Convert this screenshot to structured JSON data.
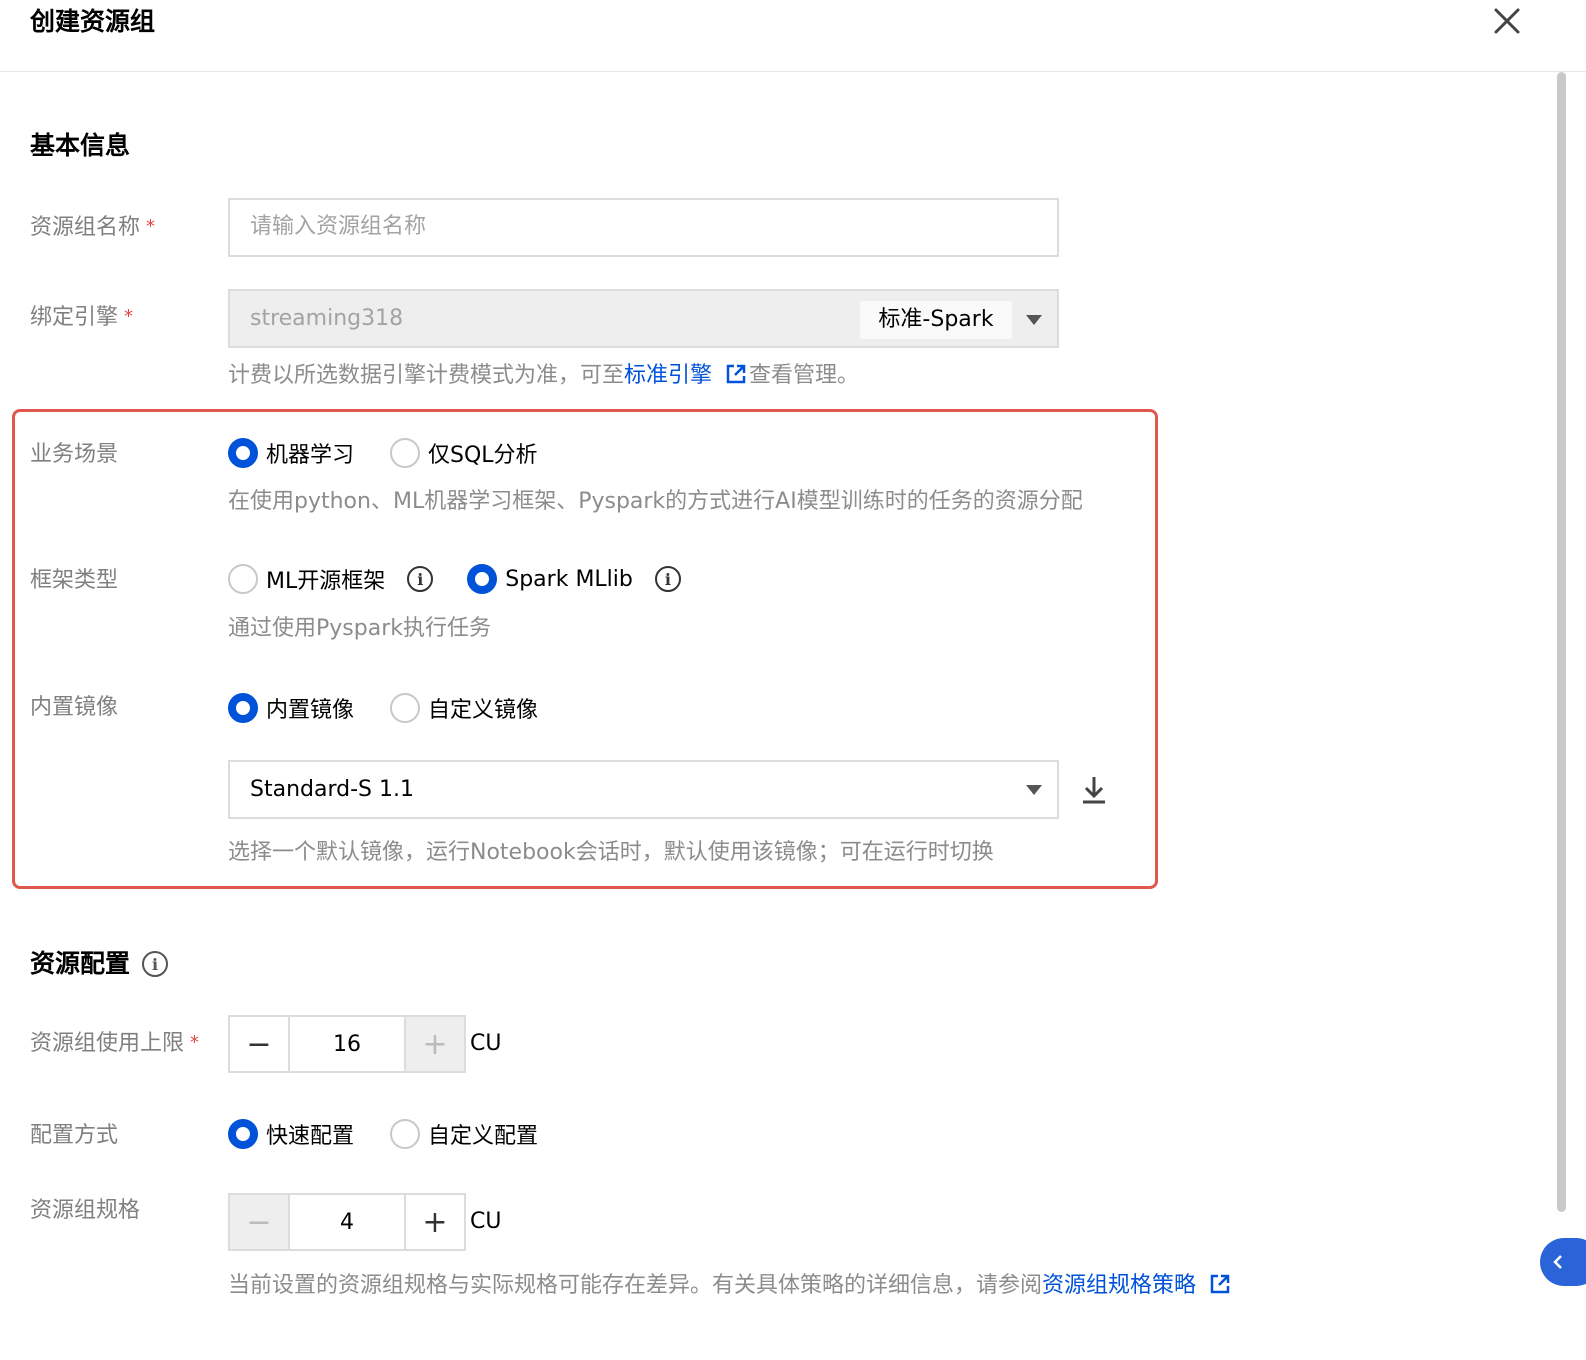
{
  "dialog": {
    "title": "创建资源组",
    "close_icon": "close-icon"
  },
  "basic": {
    "section_title": "基本信息",
    "name": {
      "label": "资源组名称",
      "required_mark": "*",
      "placeholder": "请输入资源组名称"
    },
    "engine": {
      "label": "绑定引擎",
      "required_mark": "*",
      "value": "streaming318",
      "engine_type": "标准-Spark",
      "hint_prefix": "计费以所选数据引擎计费模式为准，可至",
      "hint_link": "标准引擎",
      "hint_suffix": "查看管理。"
    }
  },
  "scenario": {
    "label": "业务场景",
    "options": [
      "机器学习",
      "仅SQL分析"
    ],
    "selected": 0,
    "hint": "在使用python、ML机器学习框架、Pyspark的方式进行AI模型训练时的任务的资源分配"
  },
  "framework": {
    "label": "框架类型",
    "options": [
      "ML开源框架",
      "Spark MLlib"
    ],
    "selected": 1,
    "hint": "通过使用Pyspark执行任务"
  },
  "image": {
    "label": "内置镜像",
    "options": [
      "内置镜像",
      "自定义镜像"
    ],
    "selected": 0,
    "select_value": "Standard-S 1.1",
    "hint": "选择一个默认镜像，运行Notebook会话时，默认使用该镜像；可在运行时切换"
  },
  "resource": {
    "section_title": "资源配置",
    "limit": {
      "label": "资源组使用上限",
      "required_mark": "*",
      "value": "16",
      "unit": "CU"
    },
    "config_mode": {
      "label": "配置方式",
      "options": [
        "快速配置",
        "自定义配置"
      ],
      "selected": 0
    },
    "spec": {
      "label": "资源组规格",
      "value": "4",
      "unit": "CU",
      "hint_prefix": "当前设置的资源组规格与实际规格可能存在差异。有关具体策略的详细信息，请参阅",
      "hint_link": "资源组规格策略"
    }
  },
  "colors": {
    "primary": "#0052d9",
    "highlight_frame": "#e0574e",
    "required": "#e54545"
  }
}
